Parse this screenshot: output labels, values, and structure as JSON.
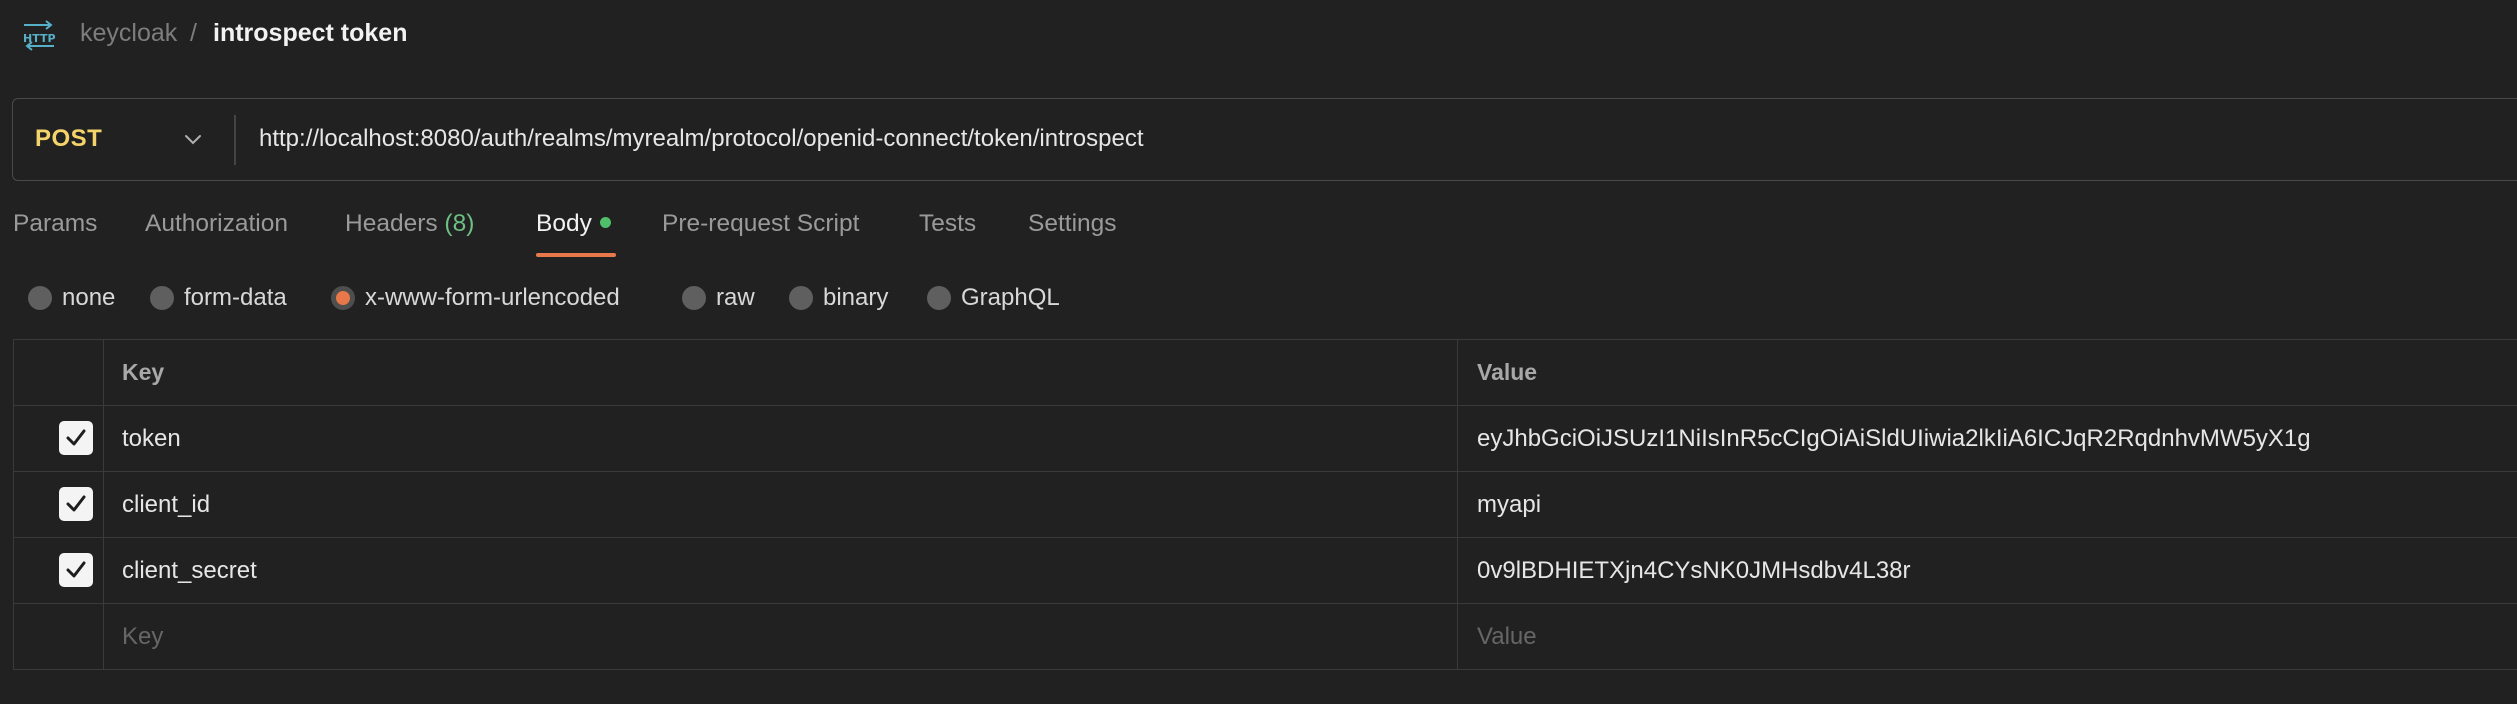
{
  "breadcrumb": {
    "collection": "keycloak",
    "separator": "/",
    "request": "introspect token"
  },
  "request": {
    "method": "POST",
    "url": "http://localhost:8080/auth/realms/myrealm/protocol/openid-connect/token/introspect"
  },
  "tabs": [
    {
      "label": "Params"
    },
    {
      "label": "Authorization"
    },
    {
      "label": "Headers",
      "count": "(8)"
    },
    {
      "label": "Body",
      "active": true,
      "indicator": "green-dot"
    },
    {
      "label": "Pre-request Script"
    },
    {
      "label": "Tests"
    },
    {
      "label": "Settings"
    }
  ],
  "body_types": [
    {
      "label": "none"
    },
    {
      "label": "form-data"
    },
    {
      "label": "x-www-form-urlencoded",
      "selected": true
    },
    {
      "label": "raw"
    },
    {
      "label": "binary"
    },
    {
      "label": "GraphQL"
    }
  ],
  "table": {
    "headers": {
      "key": "Key",
      "value": "Value"
    },
    "rows": [
      {
        "checked": true,
        "key": "token",
        "value": "eyJhbGciOiJSUzI1NiIsInR5cCIgOiAiSldUIiwia2lkIiA6ICJqR2RqdnhvMW5yX1g"
      },
      {
        "checked": true,
        "key": "client_id",
        "value": "myapi"
      },
      {
        "checked": true,
        "key": "client_secret",
        "value": "0v9lBDHIETXjn4CYsNK0JMHsdbv4L38r"
      }
    ],
    "placeholder": {
      "key": "Key",
      "value": "Value"
    }
  },
  "colors": {
    "background": "#212121",
    "method": "#f5d36b",
    "accent": "#e8784a",
    "dot": "#4fbf6a"
  }
}
